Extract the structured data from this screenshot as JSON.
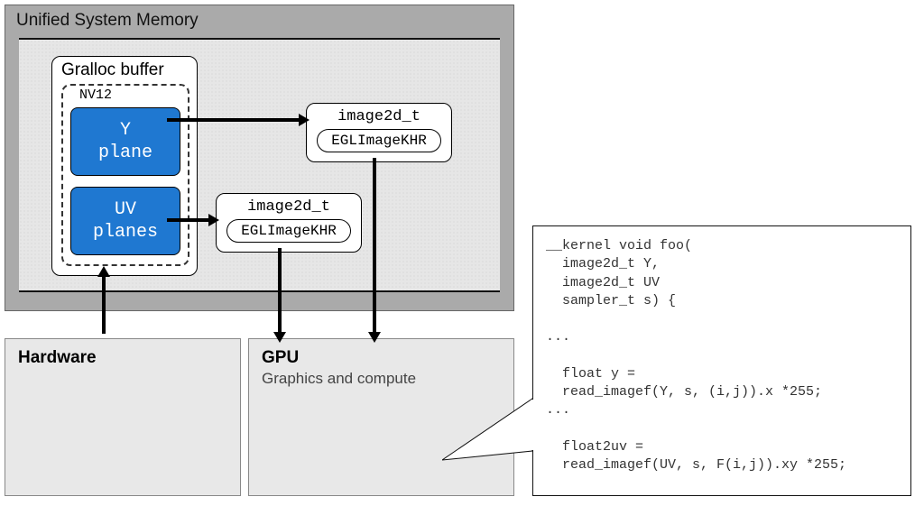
{
  "usm_title": "Unified System Memory",
  "gralloc_title": "Gralloc buffer",
  "nv12_label": "NV12",
  "y_plane_l1": "Y",
  "y_plane_l2": "plane",
  "uv_plane_l1": "UV",
  "uv_plane_l2": "planes",
  "img_type": "image2d_t",
  "egl_type": "EGLImageKHR",
  "hardware_title": "Hardware",
  "gpu_title": "GPU",
  "gpu_sub": "Graphics and compute",
  "code": "__kernel void foo(\n  image2d_t Y,\n  image2d_t UV\n  sampler_t s) {\n\n...\n\n  float y =\n  read_imagef(Y, s, (i,j)).x *255;\n...\n\n  float2uv =\n  read_imagef(UV, s, F(i,j)).xy *255;"
}
